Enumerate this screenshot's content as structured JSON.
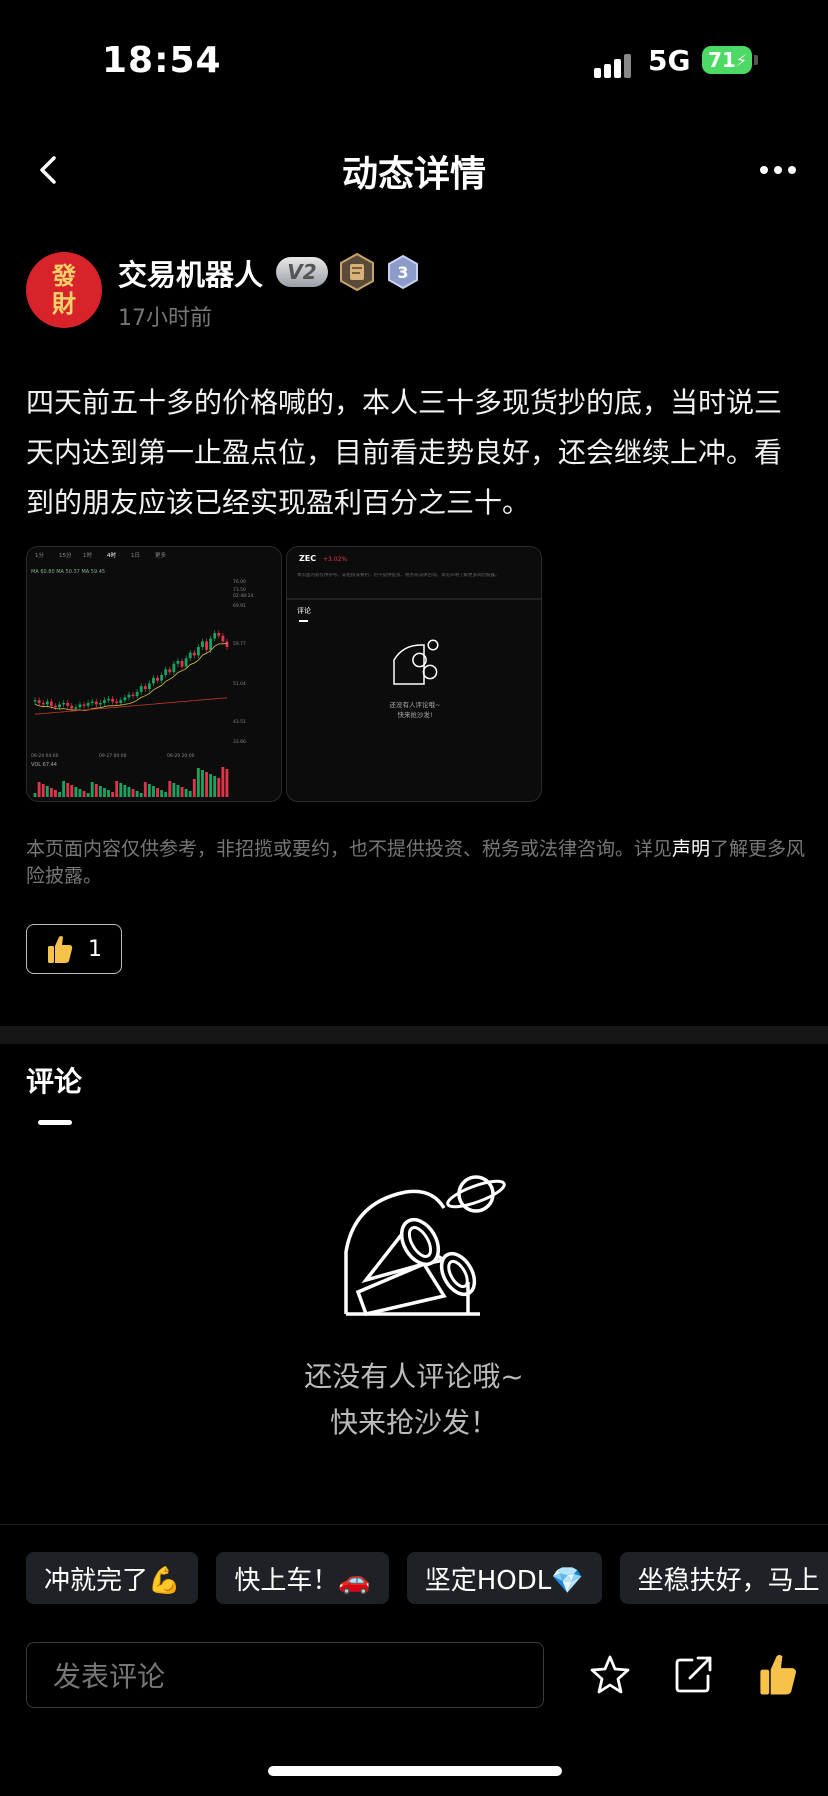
{
  "status_bar": {
    "time": "18:54",
    "network": "5G",
    "battery": "71"
  },
  "header": {
    "title": "动态详情",
    "back_icon": "chevron-left-icon",
    "more_icon": "more-dots-icon"
  },
  "author": {
    "avatar_text": [
      "發",
      "財"
    ],
    "name": "交易机器人",
    "badge_vip": "V2",
    "badge_level": "3",
    "time": "17小时前"
  },
  "post": {
    "text": "四天前五十多的价格喊的，本人三十多现货抄的底，当时说三天内达到第一止盈点位，目前看走势良好，还会继续上冲。看到的朋友应该已经实现盈利百分之三十。",
    "images": [
      {
        "tabs": [
          "1分",
          "15分",
          "1时",
          "4时",
          "1日",
          "更多"
        ],
        "price_labels": [
          "76.00",
          "73.50",
          "02:48:24",
          "69.91",
          "59.77",
          "51.04",
          "43.51",
          "33.66"
        ],
        "date_labels": [
          "09-24 04:00",
          "09-27 00:00",
          "09-29 20:00"
        ],
        "legend": "MA 60.80  MA 50.37  MA 59.45",
        "volume_label": "VOL 67.44"
      },
      {
        "symbol": "ZEC",
        "change": "+3.02%",
        "disclaimer": "本页面内容仅供参考，非招揽或要约，也不提供投资、税务或法律咨询。详见声明了解更多风险披露。",
        "comment_tab": "评论",
        "empty_line1": "还没有人评论哦~",
        "empty_line2": "快来抢沙发!"
      }
    ]
  },
  "disclaimer": {
    "text": "本页面内容仅供参考，非招揽或要约，也不提供投资、税务或法律咨询。详见",
    "link": "声明",
    "tail": "了解更多风险披露。"
  },
  "like": {
    "icon": "thumbs-up-icon",
    "count": "1"
  },
  "comments": {
    "title": "评论",
    "empty_line1": "还没有人评论哦~",
    "empty_line2": "快来抢沙发！"
  },
  "quick_replies": [
    "冲就完了💪",
    "快上车！🚗",
    "坚定HODL💎",
    "坐稳扶好，马上"
  ],
  "composer": {
    "placeholder": "发表评论",
    "icons": [
      "star-icon",
      "share-icon",
      "thumbs-up-icon"
    ]
  },
  "colors": {
    "avatar_bg": "#d8232a",
    "battery": "#4cd964",
    "up": "#1aa260",
    "down": "#e0344b"
  }
}
